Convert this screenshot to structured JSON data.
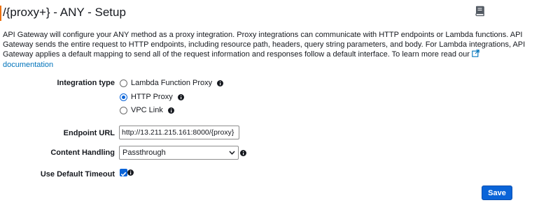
{
  "header": {
    "title": "/{proxy+} - ANY - Setup"
  },
  "description": {
    "text": "API Gateway will configure your ANY method as a proxy integration. Proxy integrations can communicate with HTTP endpoints or Lambda functions. API Gateway sends the entire request to HTTP endpoints, including resource path, headers, query string parameters, and body. For Lambda integrations, API Gateway applies a default mapping to send all of the request information and responses follow a default interface. To learn more read our ",
    "link_label": "documentation"
  },
  "form": {
    "integration_type": {
      "label": "Integration type",
      "options": [
        {
          "label": "Lambda Function Proxy",
          "selected": false
        },
        {
          "label": "HTTP Proxy",
          "selected": true
        },
        {
          "label": "VPC Link",
          "selected": false
        }
      ]
    },
    "endpoint_url": {
      "label": "Endpoint URL",
      "value": "http://13.211.215.161:8000/{proxy}"
    },
    "content_handling": {
      "label": "Content Handling",
      "value": "Passthrough"
    },
    "default_timeout": {
      "label": "Use Default Timeout",
      "checked": true
    }
  },
  "actions": {
    "save_label": "Save"
  },
  "colors": {
    "accent": "#ec7211",
    "primary": "#0a64d8",
    "link": "#0073bb"
  },
  "icons": {
    "info": "info-icon",
    "book": "book-icon",
    "external": "external-link-icon",
    "chevron": "chevron-down-icon"
  }
}
